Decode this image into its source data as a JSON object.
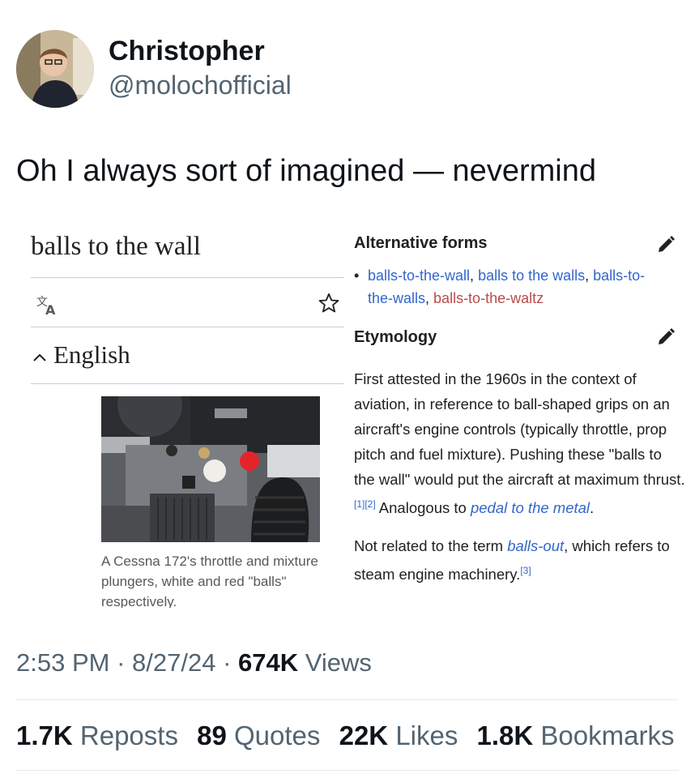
{
  "author": {
    "display_name": "Christopher",
    "handle": "@molochofficial"
  },
  "tweet": {
    "text": "Oh I always sort of imagined — nevermind"
  },
  "embedded": {
    "title": "balls to the wall",
    "language": "English",
    "caption": "A Cessna 172's throttle and mixture plungers, white and red \"balls\" respectively.",
    "alternative_forms_heading": "Alternative forms",
    "alternative_forms": [
      {
        "text": "balls-to-the-wall",
        "color": "#3366cc"
      },
      {
        "text": "balls to the walls",
        "color": "#3366cc"
      },
      {
        "text": "balls-to-the-walls",
        "color": "#3366cc"
      },
      {
        "text": "balls-to-the-waltz",
        "color": "#ba4b4b"
      }
    ],
    "etymology_heading": "Etymology",
    "etymology_p1_text": "First attested in the 1960s in the context of aviation, in reference to ball-shaped grips on an aircraft's engine controls (typically throttle, prop pitch and fuel mixture). Pushing these \"balls to the wall\" would put the aircraft at maximum thrust.",
    "etymology_p1_refs": "[1][2]",
    "etymology_p1_cont": " Analogous to ",
    "etymology_p1_link": "pedal to the metal",
    "etymology_p1_end": ".",
    "etymology_p2_start": "Not related to the term ",
    "etymology_p2_link": "balls-out",
    "etymology_p2_mid": ", which refers to steam engine machinery.",
    "etymology_p2_ref": "[3]"
  },
  "meta": {
    "time": "2:53 PM",
    "date": "8/27/24",
    "views_count": "674K",
    "views_label": "Views"
  },
  "stats": [
    {
      "count": "1.7K",
      "label": "Reposts"
    },
    {
      "count": "89",
      "label": "Quotes"
    },
    {
      "count": "22K",
      "label": "Likes"
    },
    {
      "count": "1.8K",
      "label": "Bookmarks"
    }
  ],
  "colors": {
    "link": "#3366cc",
    "redlink": "#ba4b4b",
    "secondary_text": "#536471"
  }
}
